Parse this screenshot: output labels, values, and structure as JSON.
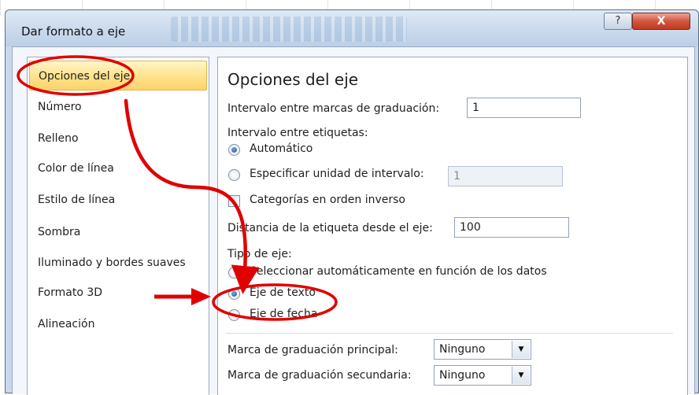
{
  "window": {
    "title": "Dar formato a eje",
    "help_label": "?",
    "close_label": "X"
  },
  "sidebar": {
    "items": [
      {
        "label": "Opciones del eje",
        "selected": true
      },
      {
        "label": "Número"
      },
      {
        "label": "Relleno"
      },
      {
        "label": "Color de línea"
      },
      {
        "label": "Estilo de línea"
      },
      {
        "label": "Sombra"
      },
      {
        "label": "Iluminado y bordes suaves"
      },
      {
        "label": "Formato 3D"
      },
      {
        "label": "Alineación"
      }
    ]
  },
  "main": {
    "section_title": "Opciones del eje",
    "tick_interval": {
      "label": "Intervalo entre marcas de graduación:",
      "value": "1"
    },
    "label_interval": {
      "heading": "Intervalo entre etiquetas:",
      "auto_label": "Automático",
      "auto_selected": true,
      "specify_label": "Especificar unidad de intervalo:",
      "specify_value": "1",
      "specify_enabled": false
    },
    "reverse_order": {
      "label": "Categorías en orden inverso",
      "checked": false
    },
    "label_distance": {
      "label": "Distancia de la etiqueta desde el eje:",
      "value": "100"
    },
    "axis_type": {
      "heading": "Tipo de eje:",
      "options": [
        {
          "label": "Seleccionar automáticamente en función de los datos",
          "selected": false
        },
        {
          "label": "Eje de texto",
          "selected": true
        },
        {
          "label": "Eje de fecha",
          "selected": false
        }
      ]
    },
    "major_tick": {
      "label": "Marca de graduación principal:",
      "value": "Ninguno"
    },
    "minor_tick": {
      "label": "Marca de graduación secundaria:",
      "value": "Ninguno"
    }
  },
  "annotations": {
    "color": "#e00000"
  },
  "colors": {
    "selected_item": "#fde28a",
    "title_bar": "#c9d9ec",
    "close_button": "#d3553f"
  }
}
